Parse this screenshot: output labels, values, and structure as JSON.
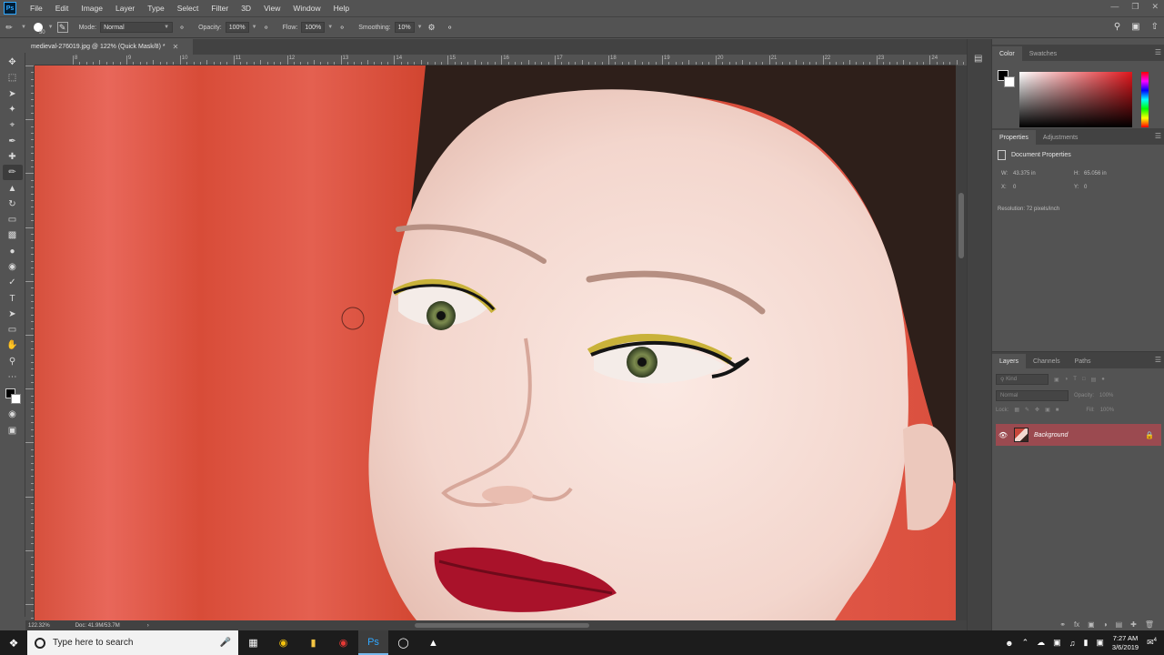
{
  "app": {
    "logo": "Ps"
  },
  "menu": [
    "File",
    "Edit",
    "Image",
    "Layer",
    "Type",
    "Select",
    "Filter",
    "3D",
    "View",
    "Window",
    "Help"
  ],
  "options": {
    "brush_size": "30",
    "mode_label": "Mode:",
    "mode_value": "Normal",
    "opacity_label": "Opacity:",
    "opacity_value": "100%",
    "flow_label": "Flow:",
    "flow_value": "100%",
    "smoothing_label": "Smoothing:",
    "smoothing_value": "10%"
  },
  "document": {
    "tab_title": "medieval-276019.jpg @ 122% (Quick Mask/8) *",
    "zoom": "122.32%",
    "doc_size": "Doc: 41.9M/53.7M"
  },
  "ruler": {
    "h_labels": [
      "8",
      "9",
      "10",
      "11",
      "12",
      "13",
      "14",
      "15",
      "16",
      "17",
      "18",
      "19",
      "20",
      "21",
      "22",
      "23",
      "24"
    ]
  },
  "color_panel": {
    "tabs": [
      "Color",
      "Swatches"
    ]
  },
  "properties_panel": {
    "tabs": [
      "Properties",
      "Adjustments"
    ],
    "title": "Document Properties",
    "w_label": "W:",
    "w_value": "43.375 in",
    "h_label": "H:",
    "h_value": "65.056 in",
    "x_label": "X:",
    "x_value": "0",
    "y_label": "Y:",
    "y_value": "0",
    "resolution": "Resolution: 72 pixels/inch"
  },
  "layers_panel": {
    "tabs": [
      "Layers",
      "Channels",
      "Paths"
    ],
    "kind_placeholder": "Kind",
    "blend_mode": "Normal",
    "opacity_label": "Opacity:",
    "opacity_value": "100%",
    "lock_label": "Lock:",
    "fill_label": "Fill:",
    "fill_value": "100%",
    "layer_name": "Background"
  },
  "taskbar": {
    "search_placeholder": "Type here to search",
    "time": "7:27 AM",
    "date": "3/6/2019",
    "notification_count": "4"
  },
  "colors": {
    "backdrop_red": "#d9533f",
    "skin": "#f3dcd4",
    "hair": "#2e1f1a",
    "lips": "#a9122a",
    "layer_highlight": "#9b4a50"
  }
}
